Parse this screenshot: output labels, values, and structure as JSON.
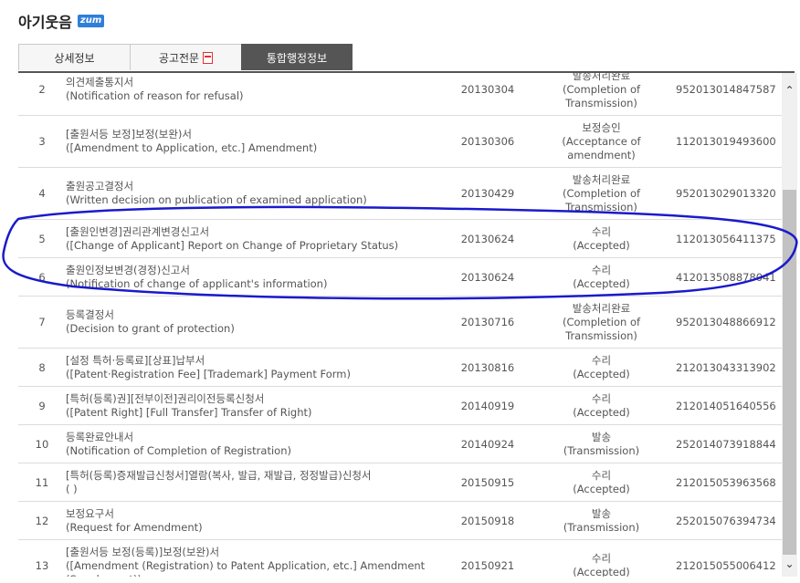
{
  "app": {
    "title": "아기웃음",
    "badge": "zum"
  },
  "tabs": [
    {
      "label": "상세정보"
    },
    {
      "label": "공고전문"
    },
    {
      "label": "통합행정정보"
    }
  ],
  "rows": [
    {
      "no": "2",
      "doc_ko": "의견제출통지서",
      "doc_en": "(Notification of reason for refusal)",
      "date": "20130304",
      "status_ko": "발송처리완료",
      "status_en1": "(Completion of",
      "status_en2": "Transmission)",
      "reg": "952013014847587"
    },
    {
      "no": "3",
      "doc_ko": "[출원서등 보정]보정(보완)서",
      "doc_en": "([Amendment to Application, etc.] Amendment)",
      "date": "20130306",
      "status_ko": "보정승인",
      "status_en1": "(Acceptance of",
      "status_en2": "amendment)",
      "reg": "112013019493600"
    },
    {
      "no": "4",
      "doc_ko": "출원공고결정서",
      "doc_en": "(Written decision on publication of examined application)",
      "date": "20130429",
      "status_ko": "발송처리완료",
      "status_en1": "(Completion of",
      "status_en2": "Transmission)",
      "reg": "952013029013320"
    },
    {
      "no": "5",
      "doc_ko": "[출원인변경]권리관계변경신고서",
      "doc_en": "([Change of Applicant] Report on Change of Proprietary Status)",
      "date": "20130624",
      "status_ko": "수리",
      "status_en1": "(Accepted)",
      "status_en2": "",
      "reg": "112013056411375"
    },
    {
      "no": "6",
      "doc_ko": "출원인정보변경(경정)신고서",
      "doc_en": "(Notification of change of applicant's information)",
      "date": "20130624",
      "status_ko": "수리",
      "status_en1": "(Accepted)",
      "status_en2": "",
      "reg": "412013508878041"
    },
    {
      "no": "7",
      "doc_ko": "등록결정서",
      "doc_en": "(Decision to grant of protection)",
      "date": "20130716",
      "status_ko": "발송처리완료",
      "status_en1": "(Completion of",
      "status_en2": "Transmission)",
      "reg": "952013048866912"
    },
    {
      "no": "8",
      "doc_ko": "[설정 특허·등록료][상표]납부서",
      "doc_en": "([Patent·Registration Fee] [Trademark] Payment Form)",
      "date": "20130816",
      "status_ko": "수리",
      "status_en1": "(Accepted)",
      "status_en2": "",
      "reg": "212013043313902"
    },
    {
      "no": "9",
      "doc_ko": "[특허(등록)권][전부이전]권리이전등록신청서",
      "doc_en": "([Patent Right] [Full Transfer] Transfer of Right)",
      "date": "20140919",
      "status_ko": "수리",
      "status_en1": "(Accepted)",
      "status_en2": "",
      "reg": "212014051640556"
    },
    {
      "no": "10",
      "doc_ko": "등록완료안내서",
      "doc_en": "(Notification of Completion of Registration)",
      "date": "20140924",
      "status_ko": "발송",
      "status_en1": "(Transmission)",
      "status_en2": "",
      "reg": "252014073918844"
    },
    {
      "no": "11",
      "doc_ko": "[특허(등록)증재발급신청서]열람(복사, 발급, 재발급, 정정발급)신청서",
      "doc_en": "( )",
      "date": "20150915",
      "status_ko": "수리",
      "status_en1": "(Accepted)",
      "status_en2": "",
      "reg": "212015053963568"
    },
    {
      "no": "12",
      "doc_ko": "보정요구서",
      "doc_en": "(Request for Amendment)",
      "date": "20150918",
      "status_ko": "발송",
      "status_en1": "(Transmission)",
      "status_en2": "",
      "reg": "252015076394734"
    },
    {
      "no": "13",
      "doc_ko": "[출원서등 보정(등록)]보정(보완)서",
      "doc_en": "([Amendment (Registration) to Patent Application, etc.] Amendment (Supplement))",
      "date": "20150921",
      "status_ko": "수리",
      "status_en1": "(Accepted)",
      "status_en2": "",
      "reg": "212015055006412"
    }
  ],
  "colors": {
    "active_tab": "#555555",
    "annotation": "#1a1acc",
    "badge": "#2f7fd8"
  }
}
